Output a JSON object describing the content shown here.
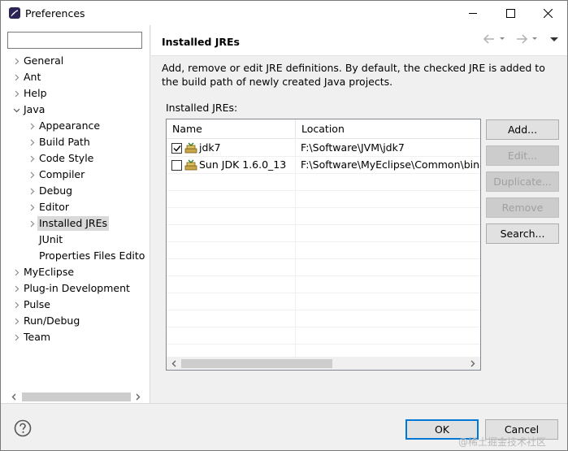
{
  "window": {
    "title": "Preferences"
  },
  "filter": {
    "value": "",
    "placeholder": ""
  },
  "tree": {
    "items": [
      {
        "label": "General"
      },
      {
        "label": "Ant"
      },
      {
        "label": "Help"
      },
      {
        "label": "Java"
      },
      {
        "label": "Appearance"
      },
      {
        "label": "Build Path"
      },
      {
        "label": "Code Style"
      },
      {
        "label": "Compiler"
      },
      {
        "label": "Debug"
      },
      {
        "label": "Editor"
      },
      {
        "label": "Installed JREs"
      },
      {
        "label": "JUnit"
      },
      {
        "label": "Properties Files Edito"
      },
      {
        "label": "MyEclipse"
      },
      {
        "label": "Plug-in Development"
      },
      {
        "label": "Pulse"
      },
      {
        "label": "Run/Debug"
      },
      {
        "label": "Team"
      }
    ],
    "selected": "Installed JREs"
  },
  "page": {
    "title": "Installed JREs",
    "description": "Add, remove or edit JRE definitions. By default, the checked JRE is added to the build path of newly created Java projects.",
    "section_label": "Installed JREs:"
  },
  "table": {
    "columns": [
      "Name",
      "Location"
    ],
    "rows": [
      {
        "checked": true,
        "name": "jdk7",
        "location": "F:\\Software\\JVM\\jdk7"
      },
      {
        "checked": false,
        "name": "Sun JDK 1.6.0_13",
        "location": "F:\\Software\\MyEclipse\\Common\\binar"
      }
    ]
  },
  "buttons": {
    "add": "Add...",
    "edit": "Edit...",
    "duplicate": "Duplicate...",
    "remove": "Remove",
    "search": "Search...",
    "ok": "OK",
    "cancel": "Cancel"
  },
  "watermark": "@稀土掘金技术社区",
  "colors": {
    "accent": "#0078d7",
    "selection": "#d9d9d9",
    "disabled_text": "#a0a0a0"
  },
  "icons": {
    "app": "eclipse-icon",
    "help": "help-circle-icon",
    "jre": "jre-library-icon"
  }
}
